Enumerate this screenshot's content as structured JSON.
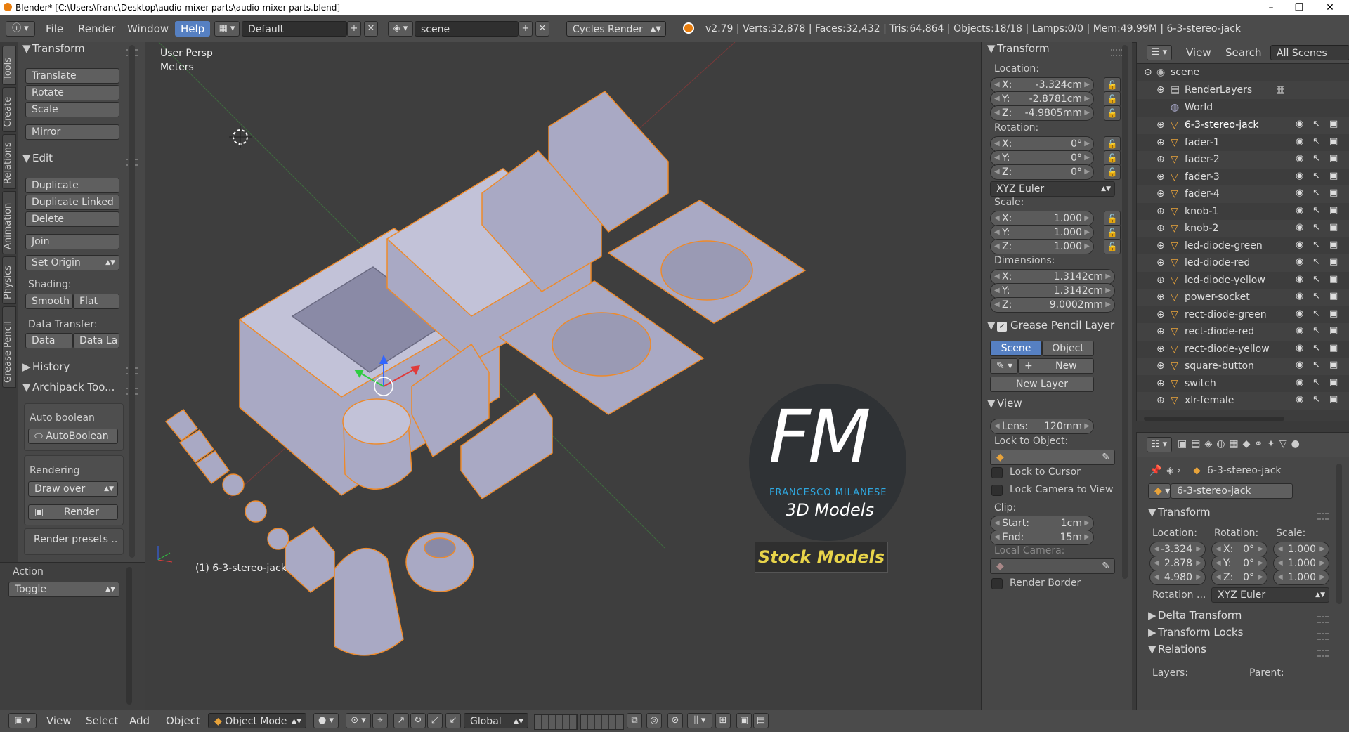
{
  "window": {
    "title": "Blender* [C:\\Users\\franc\\Desktop\\audio-mixer-parts\\audio-mixer-parts.blend]",
    "minimize": "–",
    "maximize": "❐",
    "close": "✕"
  },
  "header": {
    "menus": [
      "File",
      "Render",
      "Window",
      "Help"
    ],
    "layout": "Default",
    "scene": "scene",
    "engine": "Cycles Render",
    "stats": "v2.79 | Verts:32,878 | Faces:32,432 | Tris:64,864 | Objects:18/18 | Lamps:0/0 | Mem:49.99M | 6-3-stereo-jack"
  },
  "tabs": [
    "Tools",
    "Create",
    "Relations",
    "Animation",
    "Physics",
    "Grease Pencil"
  ],
  "toolshelf": {
    "transform_title": "Transform",
    "translate": "Translate",
    "rotate": "Rotate",
    "scale": "Scale",
    "mirror": "Mirror",
    "edit_title": "Edit",
    "duplicate": "Duplicate",
    "duplicate_linked": "Duplicate Linked",
    "delete": "Delete",
    "join": "Join",
    "set_origin": "Set Origin",
    "shading_label": "Shading:",
    "smooth": "Smooth",
    "flat": "Flat",
    "data_transfer_label": "Data Transfer:",
    "data": "Data",
    "data_la": "Data La",
    "history_title": "History",
    "archipack_title": "Archipack Too...",
    "auto_boolean_label": "Auto boolean",
    "autoboolean_btn": "AutoBoolean",
    "rendering_label": "Rendering",
    "draw_over": "Draw over",
    "render_btn": "Render",
    "render_presets": "Render presets ..."
  },
  "action": {
    "title": "Action",
    "value": "Toggle"
  },
  "viewport": {
    "view_name": "User Persp",
    "units": "Meters",
    "active_object": "(1) 6-3-stereo-jack",
    "watermark_big": "FM",
    "watermark_name": "FRANCESCO MILANESE",
    "watermark_sub": "3D Models",
    "watermark_stock": "Stock Models"
  },
  "npanel": {
    "transform_title": "Transform",
    "location_label": "Location:",
    "loc": [
      {
        "k": "X:",
        "v": "-3.324cm"
      },
      {
        "k": "Y:",
        "v": "-2.8781cm"
      },
      {
        "k": "Z:",
        "v": "-4.9805mm"
      }
    ],
    "rotation_label": "Rotation:",
    "rot": [
      {
        "k": "X:",
        "v": "0°"
      },
      {
        "k": "Y:",
        "v": "0°"
      },
      {
        "k": "Z:",
        "v": "0°"
      }
    ],
    "rotation_mode": "XYZ Euler",
    "scale_label": "Scale:",
    "scale": [
      {
        "k": "X:",
        "v": "1.000"
      },
      {
        "k": "Y:",
        "v": "1.000"
      },
      {
        "k": "Z:",
        "v": "1.000"
      }
    ],
    "dimensions_label": "Dimensions:",
    "dim": [
      {
        "k": "X:",
        "v": "1.3142cm"
      },
      {
        "k": "Y:",
        "v": "1.3142cm"
      },
      {
        "k": "Z:",
        "v": "9.0002mm"
      }
    ],
    "gp_title": "Grease Pencil Layer",
    "scene_btn": "Scene",
    "object_btn": "Object",
    "new_btn": "New",
    "new_layer": "New Layer",
    "view_title": "View",
    "lens_k": "Lens:",
    "lens_v": "120mm",
    "lock_to_object": "Lock to Object:",
    "lock_to_cursor": "Lock to Cursor",
    "lock_camera": "Lock Camera to View",
    "clip_label": "Clip:",
    "start_k": "Start:",
    "start_v": "1cm",
    "end_k": "End:",
    "end_v": "15m",
    "local_camera": "Local Camera:",
    "render_border": "Render Border"
  },
  "outliner": {
    "view": "View",
    "search": "Search",
    "filter": "All Scenes",
    "scene": "scene",
    "render_layers": "RenderLayers",
    "world": "World",
    "objects": [
      "6-3-stereo-jack",
      "fader-1",
      "fader-2",
      "fader-3",
      "fader-4",
      "knob-1",
      "knob-2",
      "led-diode-green",
      "led-diode-red",
      "led-diode-yellow",
      "power-socket",
      "rect-diode-green",
      "rect-diode-red",
      "rect-diode-yellow",
      "square-button",
      "switch",
      "xlr-female"
    ]
  },
  "props": {
    "breadcrumb": "6-3-stereo-jack",
    "object_name": "6-3-stereo-jack",
    "transform_title": "Transform",
    "location_label": "Location:",
    "rotation_label": "Rotation:",
    "scale_label": "Scale:",
    "loc": [
      "-3.324",
      "2.878",
      "4.980"
    ],
    "rot": [
      {
        "k": "X:",
        "v": "0°"
      },
      {
        "k": "Y:",
        "v": "0°"
      },
      {
        "k": "Z:",
        "v": "0°"
      }
    ],
    "scale": [
      "1.000",
      "1.000",
      "1.000"
    ],
    "rotation_mode_label": "Rotation ...",
    "rotation_mode": "XYZ Euler",
    "delta_transform": "Delta Transform",
    "transform_locks": "Transform Locks",
    "relations": "Relations",
    "layers": "Layers:",
    "parent": "Parent:"
  },
  "bottombar": {
    "view": "View",
    "select": "Select",
    "add": "Add",
    "object": "Object",
    "mode": "Object Mode",
    "orientation": "Global"
  },
  "colors": {
    "accent": "#5680c2",
    "selection_outline": "#f08a24",
    "watermark_blue": "#2fa8e0",
    "watermark_yellow": "#e8d44a"
  }
}
